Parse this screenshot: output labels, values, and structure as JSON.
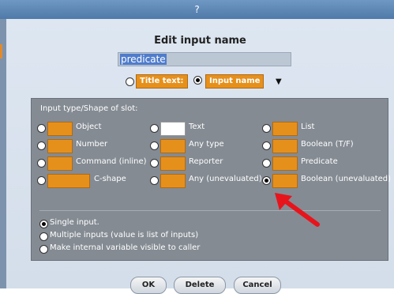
{
  "window": {
    "title": "?"
  },
  "dialog": {
    "heading": "Edit input name",
    "name_value": "predicate",
    "title_text_label": "Title text:",
    "input_name_label": "Input name",
    "selected_kind": "Input name"
  },
  "panel": {
    "heading": "Input type/Shape of slot:",
    "options": [
      {
        "label": "Object",
        "selected": false
      },
      {
        "label": "Text",
        "selected": false
      },
      {
        "label": "List",
        "selected": false
      },
      {
        "label": "Number",
        "selected": false
      },
      {
        "label": "Any type",
        "selected": false
      },
      {
        "label": "Boolean (T/F)",
        "selected": false
      },
      {
        "label": "Command (inline)",
        "selected": false
      },
      {
        "label": "Reporter",
        "selected": false
      },
      {
        "label": "Predicate",
        "selected": false
      },
      {
        "label": "C-shape",
        "selected": false
      },
      {
        "label": "Any (unevaluated)",
        "selected": false
      },
      {
        "label": "Boolean (unevaluated)",
        "selected": true
      }
    ],
    "input_modes": [
      {
        "label": "Single input.",
        "selected": true
      },
      {
        "label": "Multiple inputs (value is list of inputs)",
        "selected": false
      },
      {
        "label": "Make internal variable visible to caller",
        "selected": false
      }
    ]
  },
  "buttons": {
    "ok": "OK",
    "delete": "Delete",
    "cancel": "Cancel"
  },
  "colors": {
    "accent": "#e6901c",
    "panel": "#848b93",
    "titlebar": "#5a84b3",
    "annotation": "#e8141c"
  }
}
